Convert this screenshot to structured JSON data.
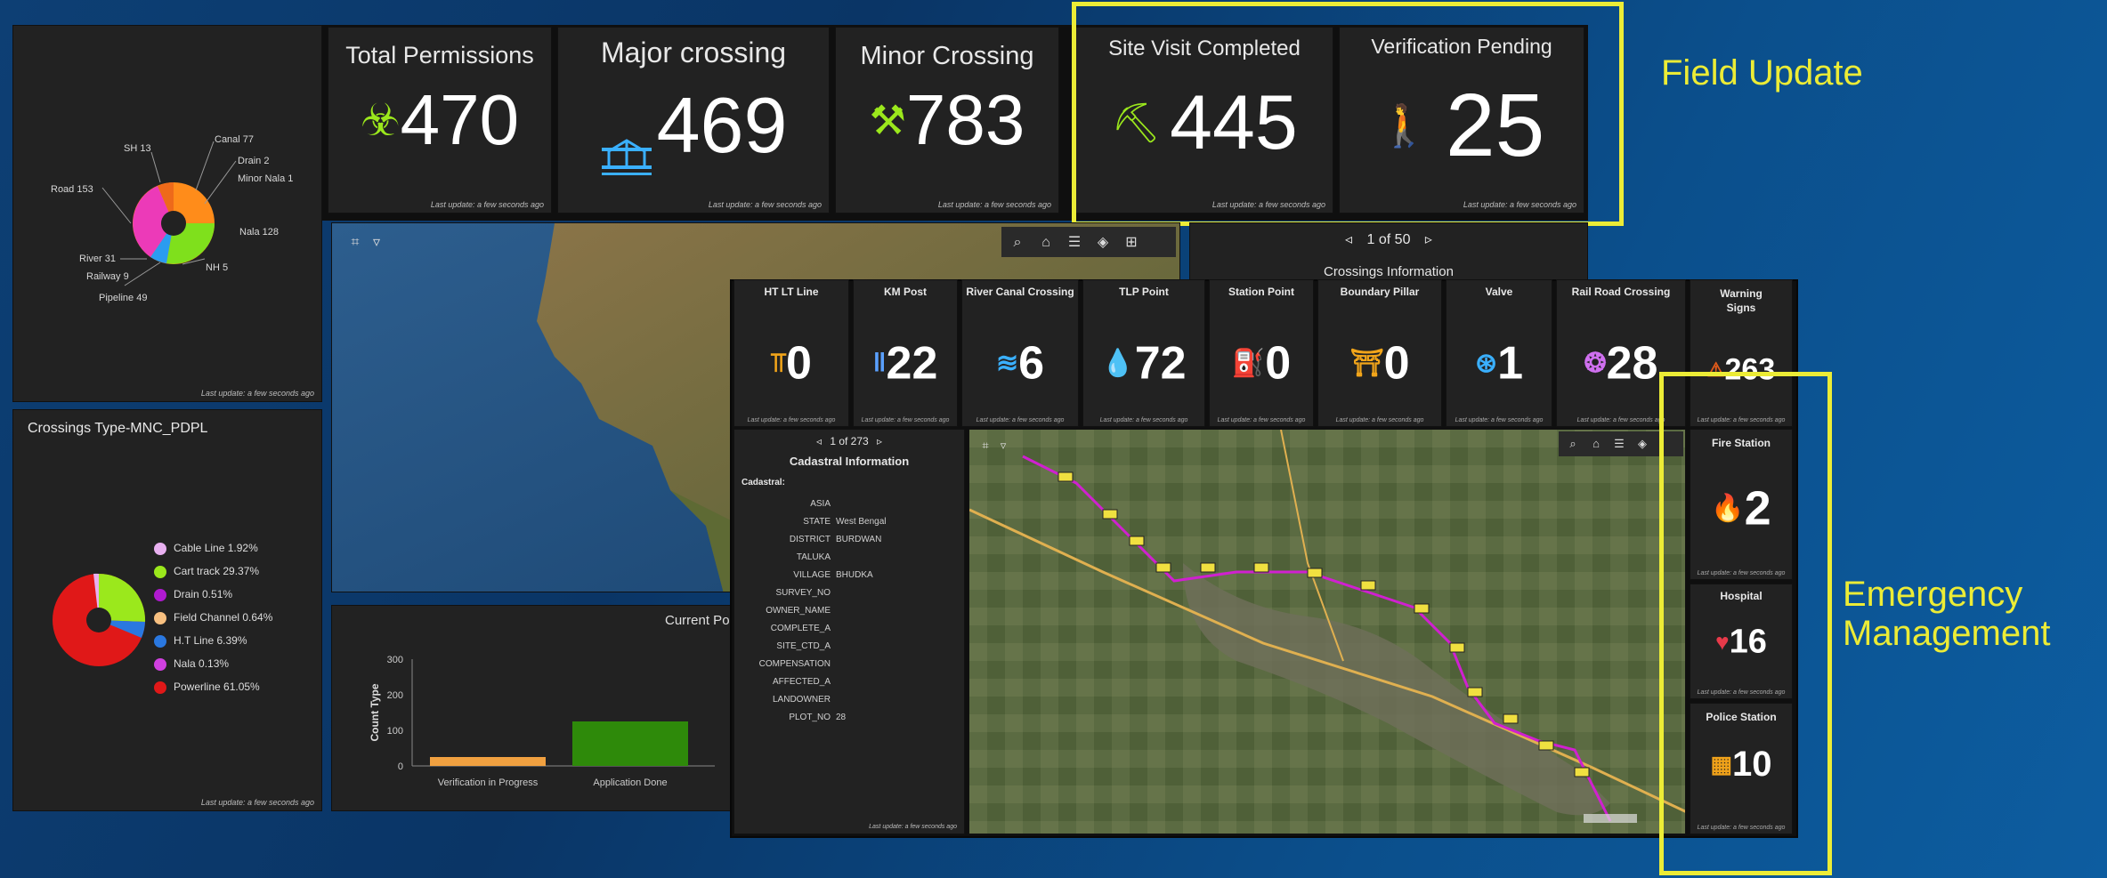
{
  "footer_text": "Last update: a few seconds ago",
  "pie1": {
    "labels": {
      "sh": "SH 13",
      "canal": "Canal 77",
      "drain": "Drain 2",
      "minor_nala": "Minor Nala 1",
      "road": "Road 153",
      "nala": "Nala 128",
      "river": "River 31",
      "nh": "NH 5",
      "railway": "Railway 9",
      "pipeline": "Pipeline 49"
    }
  },
  "indicators": {
    "total": {
      "title": "Total Permissions",
      "value": "470",
      "icon": "biohazard-icon"
    },
    "major": {
      "title": "Major crossing",
      "value": "469",
      "icon": "bridge-icon"
    },
    "minor": {
      "title": "Minor Crossing",
      "value": "783",
      "icon": "tools-icon"
    },
    "site_visit": {
      "title": "Site Visit Completed",
      "value": "445",
      "icon": "worker-icon"
    },
    "verification": {
      "title": "Verification Pending",
      "value": "25",
      "icon": "walking-person-icon"
    }
  },
  "annotations": {
    "field_update": "Field Update",
    "emergency_line1": "Emergency",
    "emergency_line2": "Management"
  },
  "pie2": {
    "title": "Crossings Type-MNC_PDPL",
    "legend": [
      {
        "label": "Cable Line  1.92%",
        "color": "#e8b0f0"
      },
      {
        "label": "Cart track  29.37%",
        "color": "#9be81c"
      },
      {
        "label": "Drain  0.51%",
        "color": "#b01ad0"
      },
      {
        "label": "Field Channel  0.64%",
        "color": "#f8c080"
      },
      {
        "label": "H.T Line  6.39%",
        "color": "#2a78e0"
      },
      {
        "label": "Nala  0.13%",
        "color": "#d040e0"
      },
      {
        "label": "Powerline  61.05%",
        "color": "#e01818"
      }
    ]
  },
  "map1": {
    "tools": [
      "search-icon",
      "home-icon",
      "list-icon",
      "layers-icon",
      "grid-icon"
    ]
  },
  "bar": {
    "title": "Current Por",
    "chart_data": {
      "type": "bar",
      "categories": [
        "Verification in Progress",
        "Application Done"
      ],
      "values": [
        25,
        125
      ],
      "ylabel": "Count Type",
      "ylim": [
        0,
        300
      ],
      "yticks": [
        "300",
        "200",
        "100",
        "0"
      ],
      "colors": [
        "#f0a040",
        "#2e8a0a"
      ]
    }
  },
  "crossings": {
    "pager": "1 of 50",
    "title": "Crossings Information",
    "items": [
      {
        "title": "HT LT Line",
        "value": "0",
        "icon": "power-pole-icon",
        "color": "#f2a51a"
      },
      {
        "title": "KM Post",
        "value": "22",
        "icon": "post-icon",
        "color": "#5aa0ff"
      },
      {
        "title": "River Canal Crossing",
        "value": "6",
        "icon": "water-icon",
        "color": "#3ab0ff"
      },
      {
        "title": "TLP Point",
        "value": "72",
        "icon": "drop-icon",
        "color": "#3ab0ff"
      },
      {
        "title": "Station Point",
        "value": "0",
        "icon": "hydrant-icon",
        "color": "#e07b2a"
      },
      {
        "title": "Boundary Pillar",
        "value": "0",
        "icon": "gate-icon",
        "color": "#f2a51a"
      },
      {
        "title": "Valve",
        "value": "1",
        "icon": "valve-icon",
        "color": "#3ab0ff"
      },
      {
        "title": "Rail Road Crossing",
        "value": "28",
        "icon": "rail-icon",
        "color": "#d070f0"
      }
    ],
    "warning": {
      "title_line1": "Warning",
      "title_line2": "Signs",
      "value": "263",
      "icon": "warning-sign-icon"
    }
  },
  "cadastral": {
    "pager": "1 of 273",
    "title": "Cadastral Information",
    "section": "Cadastral:",
    "rows": [
      {
        "key": "ASIA",
        "value": ""
      },
      {
        "key": "STATE",
        "value": "West Bengal"
      },
      {
        "key": "DISTRICT",
        "value": "BURDWAN"
      },
      {
        "key": "TALUKA",
        "value": ""
      },
      {
        "key": "VILLAGE",
        "value": "BHUDKA"
      },
      {
        "key": "SURVEY_NO",
        "value": ""
      },
      {
        "key": "OWNER_NAME",
        "value": ""
      },
      {
        "key": "COMPLETE_A",
        "value": ""
      },
      {
        "key": "SITE_CTD_A",
        "value": ""
      },
      {
        "key": "COMPENSATION",
        "value": ""
      },
      {
        "key": "AFFECTED_A",
        "value": ""
      },
      {
        "key": "LANDOWNER",
        "value": ""
      },
      {
        "key": "PLOT_NO",
        "value": "28"
      }
    ]
  },
  "emergency": {
    "fire": {
      "title": "Fire Station",
      "value": "2",
      "icon": "fire-icon"
    },
    "hospital": {
      "title": "Hospital",
      "value": "16",
      "icon": "heartbeat-icon"
    },
    "police": {
      "title": "Police Station",
      "value": "10",
      "icon": "building-icon"
    }
  }
}
